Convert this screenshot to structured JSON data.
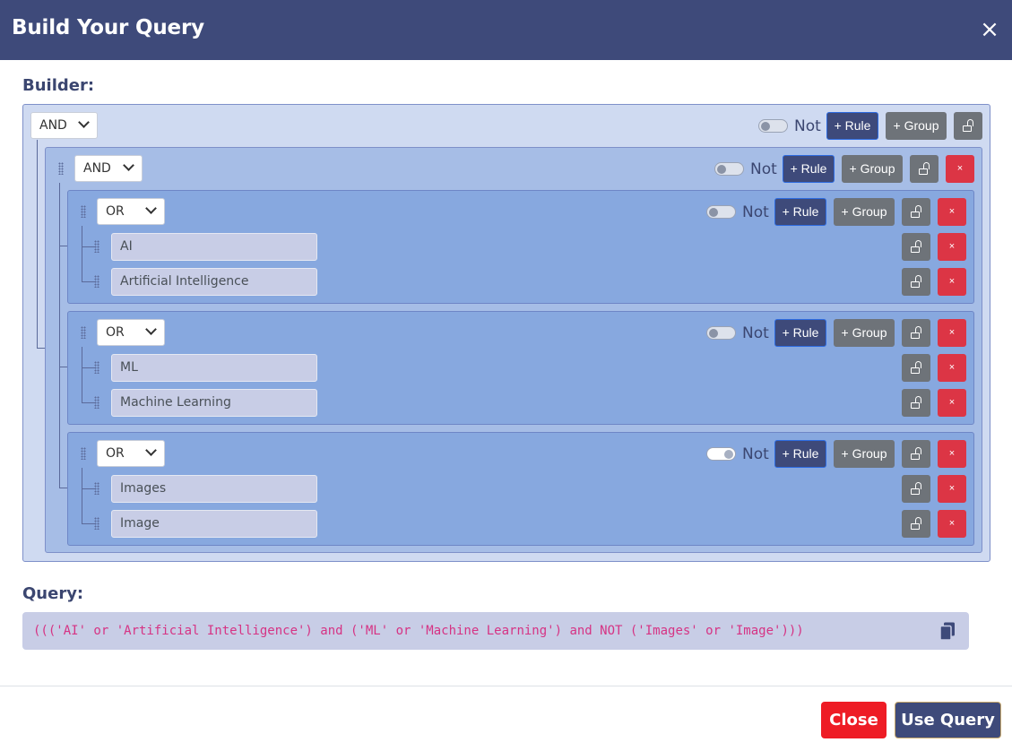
{
  "modal": {
    "title": "Build Your Query",
    "close_icon": "×"
  },
  "builder_label": "Builder:",
  "query_label": "Query:",
  "buttons": {
    "rule": "+ Rule",
    "group": "+ Group",
    "delete": "×",
    "not": "Not"
  },
  "root": {
    "operator": "AND",
    "not": false
  },
  "level1": {
    "operator": "AND",
    "not": false
  },
  "groups": [
    {
      "operator": "OR",
      "not": false,
      "rules": [
        "AI",
        "Artificial Intelligence"
      ]
    },
    {
      "operator": "OR",
      "not": false,
      "rules": [
        "ML",
        "Machine Learning"
      ]
    },
    {
      "operator": "OR",
      "not": true,
      "rules": [
        "Images",
        "Image"
      ]
    }
  ],
  "query": "((('AI' or 'Artificial Intelligence') and ('ML' or 'Machine Learning') and NOT ('Images' or 'Image')))",
  "footer": {
    "close": "Close",
    "use_query": "Use Query"
  },
  "colors": {
    "header": "#3e4a7a",
    "danger": "#dc3545",
    "secondary": "#6e7379",
    "query_text": "#d63384"
  }
}
